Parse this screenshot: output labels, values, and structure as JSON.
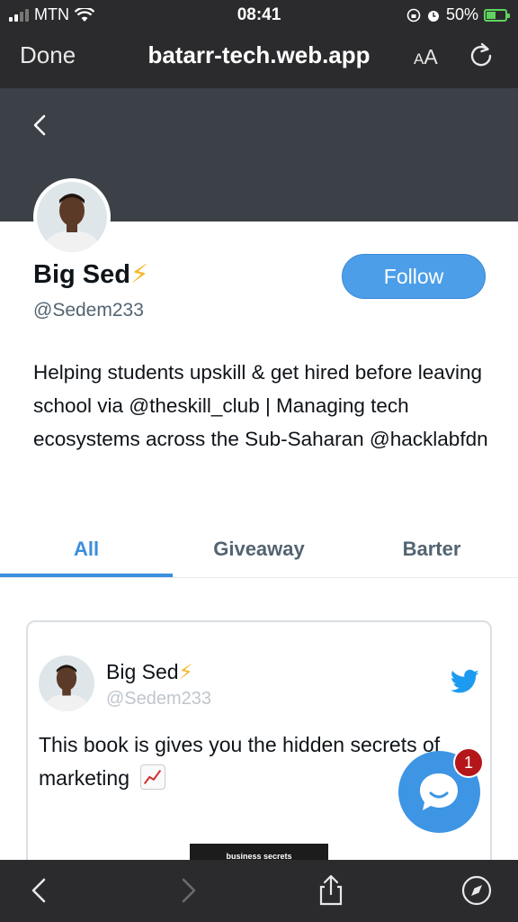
{
  "status_bar": {
    "carrier": "MTN",
    "time": "08:41",
    "battery": "50%"
  },
  "browser": {
    "done_label": "Done",
    "url": "batarr-tech.web.app",
    "aa_small": "A",
    "aa_large": "A"
  },
  "profile": {
    "name": "Big Sed",
    "emoji": "⚡",
    "handle": "@Sedem233",
    "follow_label": "Follow",
    "bio": "Helping students upskill & get hired before leaving school via @theskill_club | Managing tech ecosystems across the Sub-Saharan @hacklabfdn"
  },
  "tabs": [
    {
      "label": "All",
      "active": true
    },
    {
      "label": "Giveaway",
      "active": false
    },
    {
      "label": "Barter",
      "active": false
    }
  ],
  "tweet": {
    "name": "Big Sed",
    "emoji": "⚡",
    "handle": "@Sedem233",
    "text": "This book is gives you the hidden secrets of marketing",
    "image_text": "business secrets"
  },
  "chat": {
    "badge_count": "1"
  },
  "colors": {
    "accent": "#3a8fdc",
    "follow_button": "#4c9ee9",
    "banner": "#3c4147",
    "chrome": "#2b2b2d",
    "badge": "#b4161a"
  },
  "icons": {
    "back": "chevron-left-icon",
    "forward": "chevron-right-icon",
    "share": "share-icon",
    "compass": "compass-icon",
    "reload": "reload-icon",
    "twitter": "twitter-bird-icon",
    "chat": "chat-bubble-icon"
  }
}
